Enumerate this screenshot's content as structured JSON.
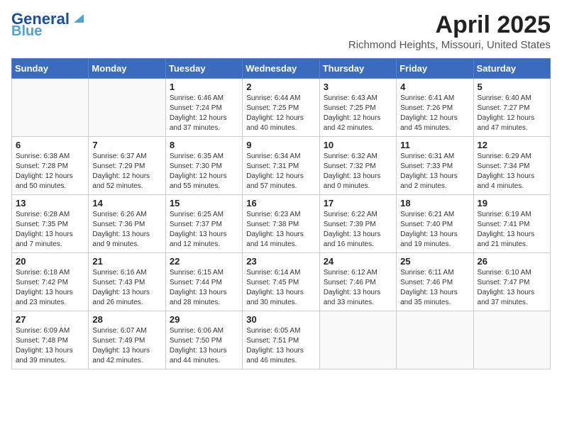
{
  "header": {
    "logo_line1": "General",
    "logo_line2": "Blue",
    "main_title": "April 2025",
    "sub_title": "Richmond Heights, Missouri, United States"
  },
  "days_of_week": [
    "Sunday",
    "Monday",
    "Tuesday",
    "Wednesday",
    "Thursday",
    "Friday",
    "Saturday"
  ],
  "weeks": [
    [
      {
        "day": "",
        "info": ""
      },
      {
        "day": "",
        "info": ""
      },
      {
        "day": "1",
        "info": "Sunrise: 6:46 AM\nSunset: 7:24 PM\nDaylight: 12 hours and 37 minutes."
      },
      {
        "day": "2",
        "info": "Sunrise: 6:44 AM\nSunset: 7:25 PM\nDaylight: 12 hours and 40 minutes."
      },
      {
        "day": "3",
        "info": "Sunrise: 6:43 AM\nSunset: 7:25 PM\nDaylight: 12 hours and 42 minutes."
      },
      {
        "day": "4",
        "info": "Sunrise: 6:41 AM\nSunset: 7:26 PM\nDaylight: 12 hours and 45 minutes."
      },
      {
        "day": "5",
        "info": "Sunrise: 6:40 AM\nSunset: 7:27 PM\nDaylight: 12 hours and 47 minutes."
      }
    ],
    [
      {
        "day": "6",
        "info": "Sunrise: 6:38 AM\nSunset: 7:28 PM\nDaylight: 12 hours and 50 minutes."
      },
      {
        "day": "7",
        "info": "Sunrise: 6:37 AM\nSunset: 7:29 PM\nDaylight: 12 hours and 52 minutes."
      },
      {
        "day": "8",
        "info": "Sunrise: 6:35 AM\nSunset: 7:30 PM\nDaylight: 12 hours and 55 minutes."
      },
      {
        "day": "9",
        "info": "Sunrise: 6:34 AM\nSunset: 7:31 PM\nDaylight: 12 hours and 57 minutes."
      },
      {
        "day": "10",
        "info": "Sunrise: 6:32 AM\nSunset: 7:32 PM\nDaylight: 13 hours and 0 minutes."
      },
      {
        "day": "11",
        "info": "Sunrise: 6:31 AM\nSunset: 7:33 PM\nDaylight: 13 hours and 2 minutes."
      },
      {
        "day": "12",
        "info": "Sunrise: 6:29 AM\nSunset: 7:34 PM\nDaylight: 13 hours and 4 minutes."
      }
    ],
    [
      {
        "day": "13",
        "info": "Sunrise: 6:28 AM\nSunset: 7:35 PM\nDaylight: 13 hours and 7 minutes."
      },
      {
        "day": "14",
        "info": "Sunrise: 6:26 AM\nSunset: 7:36 PM\nDaylight: 13 hours and 9 minutes."
      },
      {
        "day": "15",
        "info": "Sunrise: 6:25 AM\nSunset: 7:37 PM\nDaylight: 13 hours and 12 minutes."
      },
      {
        "day": "16",
        "info": "Sunrise: 6:23 AM\nSunset: 7:38 PM\nDaylight: 13 hours and 14 minutes."
      },
      {
        "day": "17",
        "info": "Sunrise: 6:22 AM\nSunset: 7:39 PM\nDaylight: 13 hours and 16 minutes."
      },
      {
        "day": "18",
        "info": "Sunrise: 6:21 AM\nSunset: 7:40 PM\nDaylight: 13 hours and 19 minutes."
      },
      {
        "day": "19",
        "info": "Sunrise: 6:19 AM\nSunset: 7:41 PM\nDaylight: 13 hours and 21 minutes."
      }
    ],
    [
      {
        "day": "20",
        "info": "Sunrise: 6:18 AM\nSunset: 7:42 PM\nDaylight: 13 hours and 23 minutes."
      },
      {
        "day": "21",
        "info": "Sunrise: 6:16 AM\nSunset: 7:43 PM\nDaylight: 13 hours and 26 minutes."
      },
      {
        "day": "22",
        "info": "Sunrise: 6:15 AM\nSunset: 7:44 PM\nDaylight: 13 hours and 28 minutes."
      },
      {
        "day": "23",
        "info": "Sunrise: 6:14 AM\nSunset: 7:45 PM\nDaylight: 13 hours and 30 minutes."
      },
      {
        "day": "24",
        "info": "Sunrise: 6:12 AM\nSunset: 7:46 PM\nDaylight: 13 hours and 33 minutes."
      },
      {
        "day": "25",
        "info": "Sunrise: 6:11 AM\nSunset: 7:46 PM\nDaylight: 13 hours and 35 minutes."
      },
      {
        "day": "26",
        "info": "Sunrise: 6:10 AM\nSunset: 7:47 PM\nDaylight: 13 hours and 37 minutes."
      }
    ],
    [
      {
        "day": "27",
        "info": "Sunrise: 6:09 AM\nSunset: 7:48 PM\nDaylight: 13 hours and 39 minutes."
      },
      {
        "day": "28",
        "info": "Sunrise: 6:07 AM\nSunset: 7:49 PM\nDaylight: 13 hours and 42 minutes."
      },
      {
        "day": "29",
        "info": "Sunrise: 6:06 AM\nSunset: 7:50 PM\nDaylight: 13 hours and 44 minutes."
      },
      {
        "day": "30",
        "info": "Sunrise: 6:05 AM\nSunset: 7:51 PM\nDaylight: 13 hours and 46 minutes."
      },
      {
        "day": "",
        "info": ""
      },
      {
        "day": "",
        "info": ""
      },
      {
        "day": "",
        "info": ""
      }
    ]
  ]
}
